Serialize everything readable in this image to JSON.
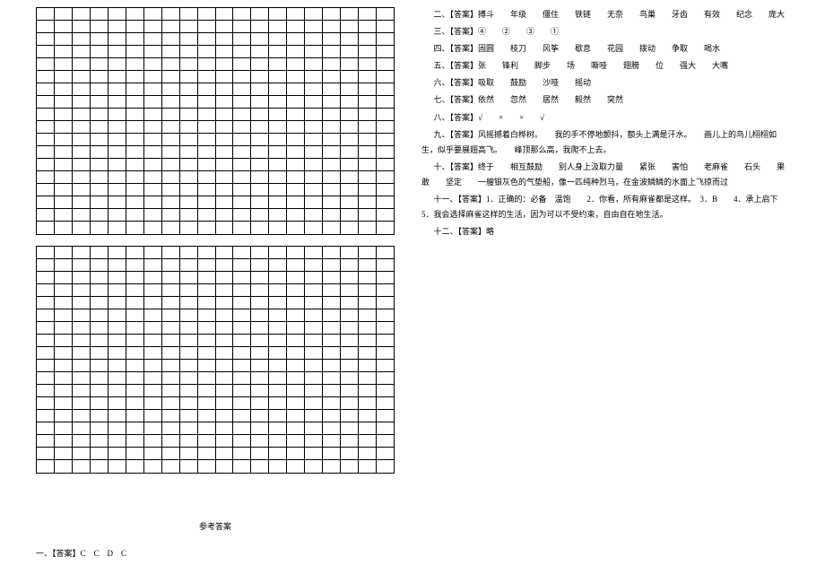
{
  "grid": {
    "block1_rows": 18,
    "block2_rows": 18,
    "cols": 20
  },
  "answers_title": "参考答案",
  "answer_1": "一、【答案】C　C　D　C",
  "answer_2": "二、【答案】搏斗　　年级　　僵住　　铁链　　无奈　　鸟巢　　牙齿　　有效　　纪念　　庞大",
  "answer_3": "三、【答案】④　　②　　③　　①",
  "answer_4": "四、【答案】固圆　　枝刀　　风筝　　歇息　　花园　　拨动　　争取　　喝水",
  "answer_5": "五、【答案】张　　锋利　　脚步　　场　　嘶哑　　翅膀　　位　　强大　　大嘴",
  "answer_6": "六、【答案】吸取　　鼓励　　沙哑　　摇动",
  "answer_7": "七、【答案】依然　　忽然　　居然　　毅然　　突然",
  "answer_8": "八、【答案】√　　×　　×　　√",
  "answer_9": "九、【答案】风摇撼着白桦树。　　我的手不停地颤抖，额头上满是汗水。　　画儿上的鸟儿栩栩如生，似乎要展翅高飞。　　峰顶那么高，我爬不上去。",
  "answer_10": "十、【答案】终于　　相互鼓励　　别人身上汲取力量　　紧张　　害怕　　老麻雀　　石头　　果敢　　坚定　　一艘银灰色的气垫船，像一匹纯种烈马，在金波鳞鳞的水面上飞掠而过",
  "answer_11": "十一、【答案】1．正确的：必备　温饱　　2．你看，所有麻雀都是这样。　3．B　　4．承上启下　　5．我会选择麻雀这样的生活，因为可以不受约束，自由自在地生活。",
  "answer_12": "十二、【答案】略"
}
